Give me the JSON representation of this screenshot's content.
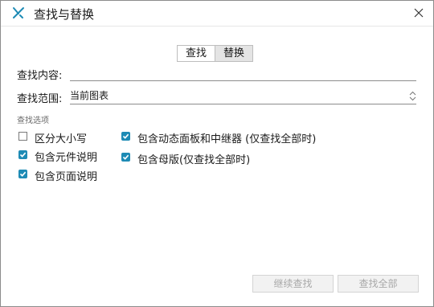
{
  "window": {
    "title": "查找与替换"
  },
  "tabs": [
    {
      "label": "查找",
      "active": true
    },
    {
      "label": "替换",
      "active": false
    }
  ],
  "find": {
    "label": "查找内容:",
    "value": "",
    "placeholder": ""
  },
  "scope": {
    "label": "查找范围:",
    "selected": "当前图表"
  },
  "options": {
    "title": "查找选项",
    "items": [
      {
        "label": "区分大小写",
        "checked": false
      },
      {
        "label": "包含元件说明",
        "checked": true
      },
      {
        "label": "包含页面说明",
        "checked": true
      },
      {
        "label": "包含动态面板和中继器 (仅查找全部时)",
        "checked": true
      },
      {
        "label": "包含母版(仅查找全部时)",
        "checked": true
      }
    ]
  },
  "buttons": {
    "continue_label": "继续查找",
    "find_all_label": "查找全部"
  },
  "colors": {
    "accent": "#1e8bb5",
    "app_icon": "#1e8bb5",
    "disabled_text": "#a8a8a8"
  },
  "icons": {
    "app": "axure-x-icon",
    "close": "close-icon",
    "scope": "updown-arrows-icon"
  }
}
